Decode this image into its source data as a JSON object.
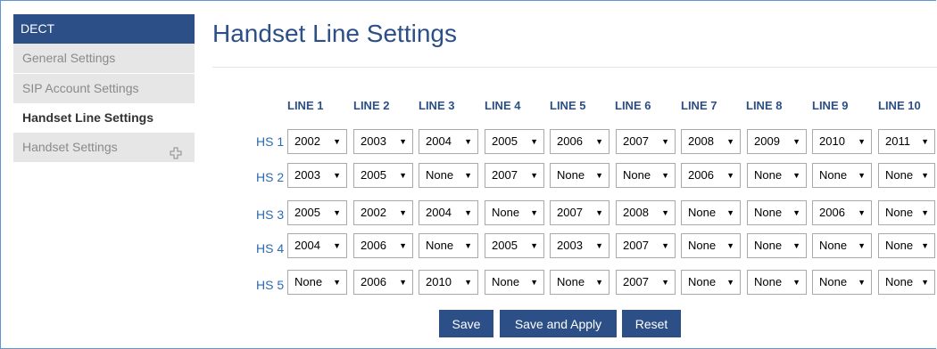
{
  "sidebar": {
    "header": "DECT",
    "items": [
      {
        "label": "General Settings"
      },
      {
        "label": "SIP Account Settings"
      },
      {
        "label": "Handset Line Settings"
      },
      {
        "label": "Handset Settings"
      }
    ]
  },
  "page_title": "Handset Line Settings",
  "columns": [
    "LINE 1",
    "LINE 2",
    "LINE 3",
    "LINE 4",
    "LINE 5",
    "LINE 6",
    "LINE 7",
    "LINE 8",
    "LINE 9",
    "LINE 10"
  ],
  "rows": [
    {
      "label": "HS 1",
      "values": [
        "2002",
        "2003",
        "2004",
        "2005",
        "2006",
        "2007",
        "2008",
        "2009",
        "2010",
        "2011"
      ]
    },
    {
      "label": "HS 2",
      "values": [
        "2003",
        "2005",
        "None",
        "2007",
        "None",
        "None",
        "2006",
        "None",
        "None",
        "None"
      ]
    },
    {
      "label": "HS 3",
      "values": [
        "2005",
        "2002",
        "2004",
        "None",
        "2007",
        "2008",
        "None",
        "None",
        "2006",
        "None"
      ]
    },
    {
      "label": "HS 4",
      "values": [
        "2004",
        "2006",
        "None",
        "2005",
        "2003",
        "2007",
        "None",
        "None",
        "None",
        "None"
      ]
    },
    {
      "label": "HS 5",
      "values": [
        "None",
        "2006",
        "2010",
        "None",
        "None",
        "2007",
        "None",
        "None",
        "None",
        "None"
      ]
    }
  ],
  "buttons": {
    "save": "Save",
    "save_apply": "Save and Apply",
    "reset": "Reset"
  },
  "icons": {
    "dropdown": "triangle-down-icon",
    "expand": "plus-icon"
  },
  "colors": {
    "accent": "#2b4f86",
    "link": "#2b6ab0",
    "sidebar_bg": "#e6e6e6"
  }
}
